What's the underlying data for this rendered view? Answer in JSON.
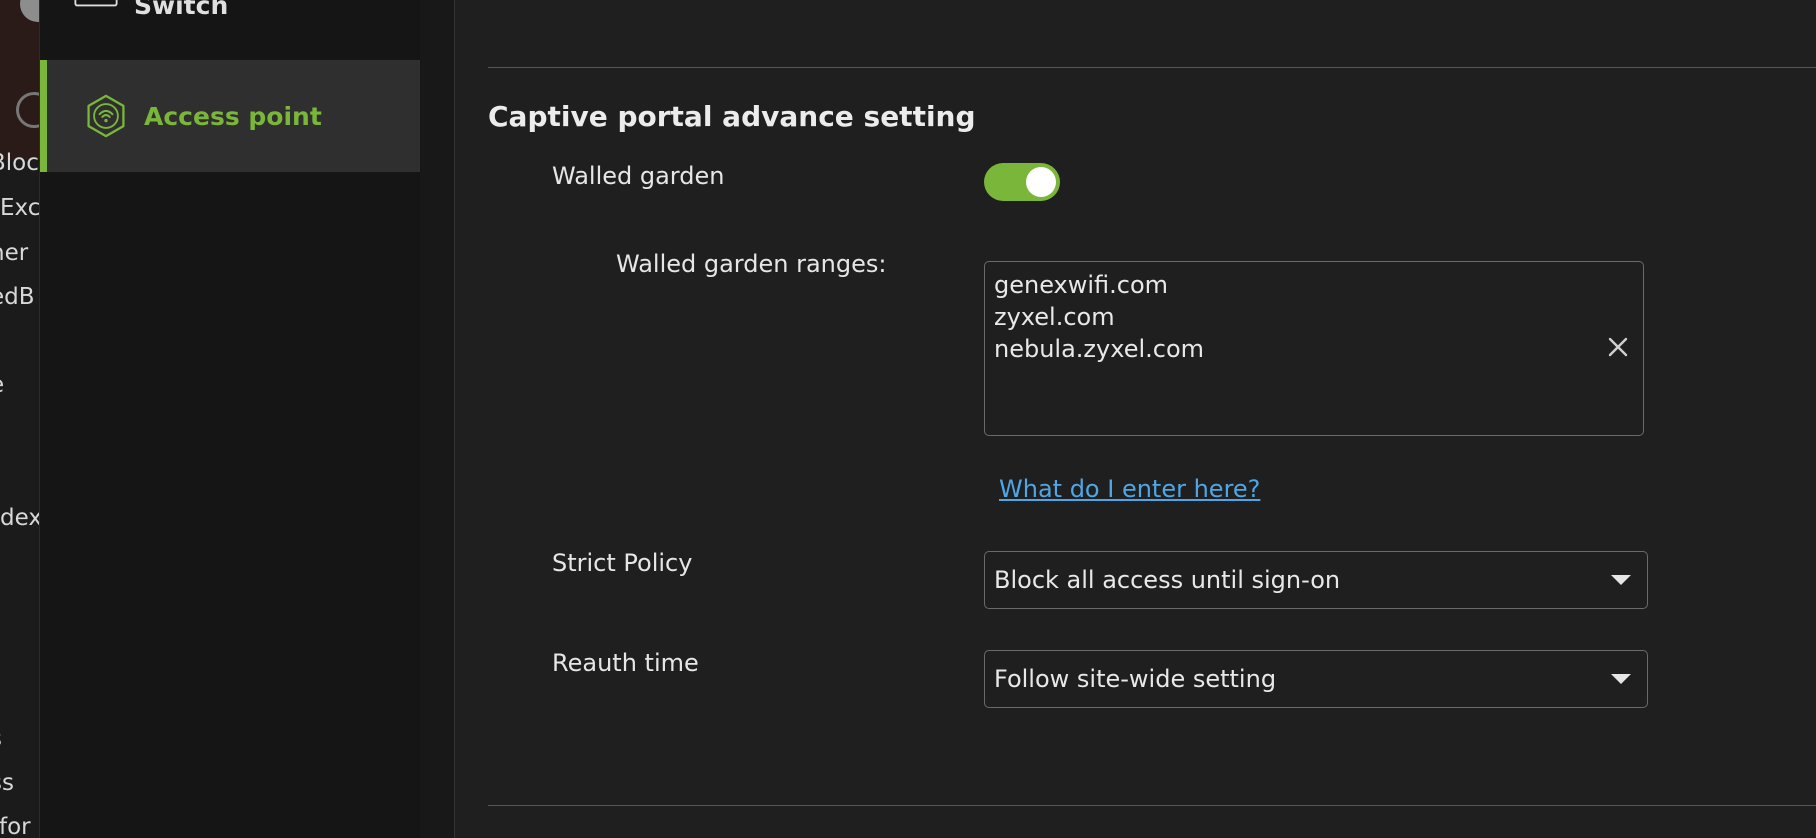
{
  "left_strip": {
    "fragments": [
      "Bloc",
      "Exc",
      "ner",
      "edB",
      "e",
      "dex",
      "s",
      "ss",
      "tfor"
    ]
  },
  "sidebar": {
    "items": [
      {
        "label": "Switch",
        "icon": "switch-icon",
        "active": false
      },
      {
        "label": "Access point",
        "icon": "access-point-icon",
        "active": true
      }
    ],
    "accent_color": "#7ab63a"
  },
  "section": {
    "title": "Captive portal advance setting"
  },
  "walled_garden": {
    "label": "Walled garden",
    "enabled": true,
    "ranges_label": "Walled garden ranges:",
    "ranges": [
      "genexwifi.com",
      "zyxel.com",
      "nebula.zyxel.com"
    ],
    "help_link": "What do I enter here?"
  },
  "strict_policy": {
    "label": "Strict Policy",
    "value": "Block all access until sign-on"
  },
  "reauth_time": {
    "label": "Reauth time",
    "value": "Follow site-wide setting"
  },
  "colors": {
    "toggle_on": "#7ab63a",
    "link": "#4fa6e6"
  }
}
